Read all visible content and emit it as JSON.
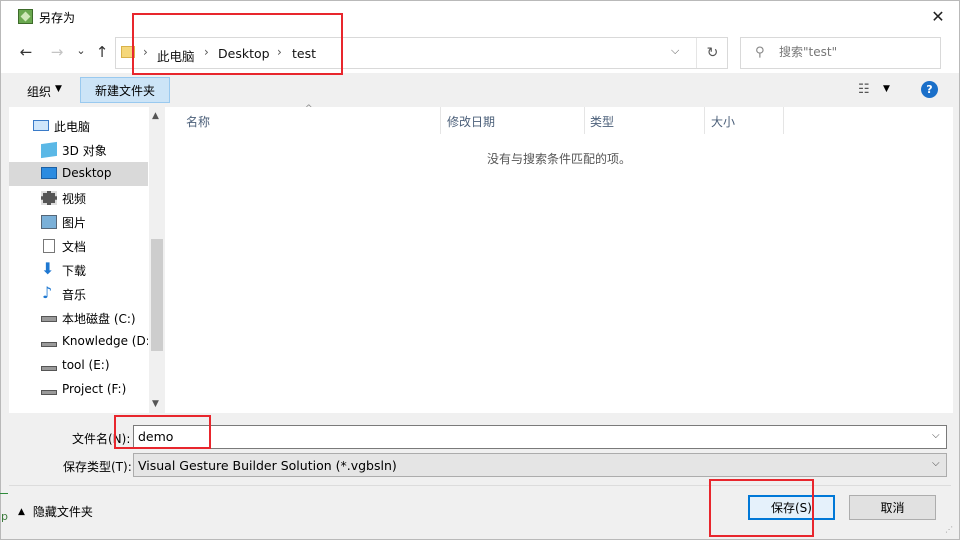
{
  "window": {
    "title": "另存为",
    "close_glyph": "✕"
  },
  "nav": {
    "back_glyph": "←",
    "forward_glyph": "→",
    "recent_glyph": "⌄",
    "up_glyph": "↑",
    "breadcrumbs": [
      "此电脑",
      "Desktop",
      "test"
    ],
    "crumb_sep": "›",
    "dropdown_glyph": "⌵",
    "refresh_glyph": "↻",
    "search_placeholder": "搜索\"test\"",
    "search_icon": "⚲"
  },
  "toolbar": {
    "organize_label": "组织",
    "organize_arrow": "▼",
    "new_folder_label": "新建文件夹",
    "view_glyph": "☷",
    "view_arrow": "▼",
    "help_glyph": "?"
  },
  "sidebar": {
    "items": [
      {
        "label": "此电脑",
        "icon": "computer-icon"
      },
      {
        "label": "3D 对象",
        "icon": "cube-icon"
      },
      {
        "label": "Desktop",
        "icon": "desktop-icon",
        "selected": true
      },
      {
        "label": "视频",
        "icon": "video-icon"
      },
      {
        "label": "图片",
        "icon": "picture-icon"
      },
      {
        "label": "文档",
        "icon": "document-icon"
      },
      {
        "label": "下载",
        "icon": "download-icon"
      },
      {
        "label": "音乐",
        "icon": "music-icon"
      },
      {
        "label": "本地磁盘 (C:)",
        "icon": "system-drive-icon"
      },
      {
        "label": "Knowledge (D:",
        "icon": "drive-icon"
      },
      {
        "label": "tool (E:)",
        "icon": "drive-icon"
      },
      {
        "label": "Project (F:)",
        "icon": "drive-icon"
      }
    ],
    "scroll_up": "▲",
    "scroll_down": "▼"
  },
  "file_list": {
    "columns": [
      "名称",
      "修改日期",
      "类型",
      "大小"
    ],
    "sort_glyph": "^",
    "empty_message": "没有与搜索条件匹配的项。"
  },
  "form": {
    "filename_label": "文件名(N):",
    "filename_value": "demo",
    "filetype_label": "保存类型(T):",
    "filetype_value": "Visual Gesture Builder Solution (*.vgbsln)",
    "dropdown_glyph": "⌵"
  },
  "footer": {
    "hide_folders_caret": "▲",
    "hide_folders_label": "隐藏文件夹",
    "save_label": "保存(S)",
    "cancel_label": "取消"
  },
  "background_window": {
    "edge_letter": "p"
  },
  "colors": {
    "accent": "#0078d7",
    "selection": "#cce4f7",
    "annotation": "#e8262d"
  }
}
